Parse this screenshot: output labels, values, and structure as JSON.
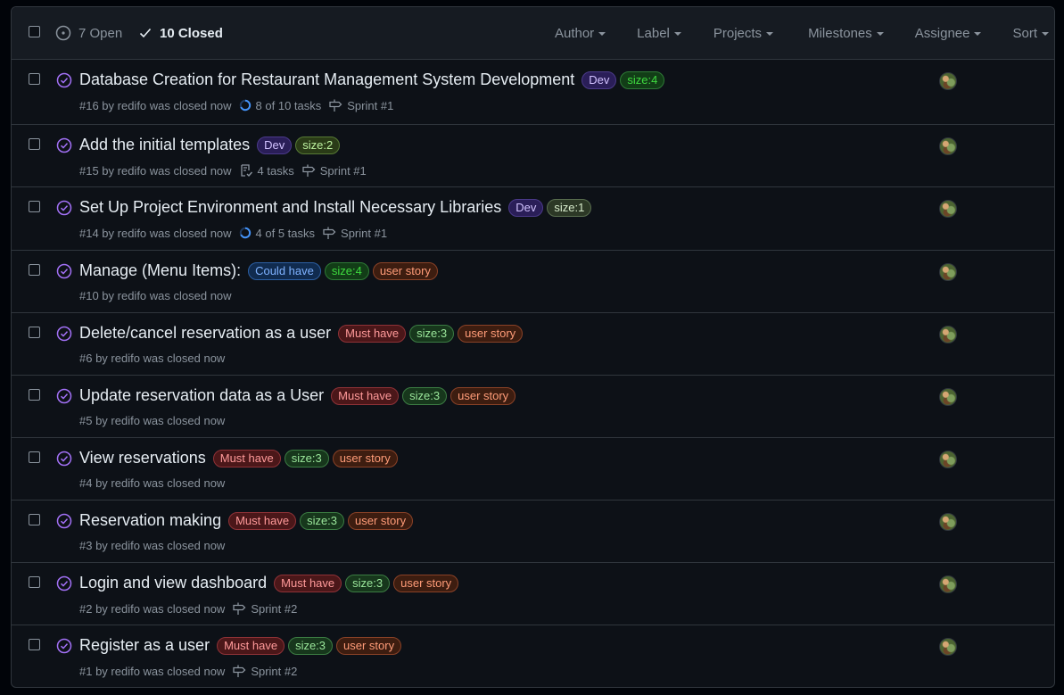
{
  "header": {
    "open_label": "7 Open",
    "closed_label": "10 Closed",
    "filters": [
      "Author",
      "Label",
      "Projects",
      "Milestones",
      "Assignee",
      "Sort"
    ]
  },
  "colors": {
    "closed_icon": "#a371f7",
    "background": "#0d1117",
    "header_bg": "#161b22",
    "border": "#30363d"
  },
  "issues": [
    {
      "title": "Database Creation for Restaurant Management System Development",
      "labels": [
        {
          "text": "Dev",
          "kind": "dev"
        },
        {
          "text": "size:4",
          "kind": "size4"
        }
      ],
      "meta": "#16 by redifo was closed now",
      "tasks": "8 of 10 tasks",
      "tasks_icon": "progress-ring-icon",
      "milestone": "Sprint #1"
    },
    {
      "title": "Add the initial templates",
      "labels": [
        {
          "text": "Dev",
          "kind": "dev"
        },
        {
          "text": "size:2",
          "kind": "size2"
        }
      ],
      "meta": "#15 by redifo was closed now",
      "tasks": "4 tasks",
      "tasks_icon": "checklist-icon",
      "milestone": "Sprint #1"
    },
    {
      "title": "Set Up Project Environment and Install Necessary Libraries",
      "labels": [
        {
          "text": "Dev",
          "kind": "dev"
        },
        {
          "text": "size:1",
          "kind": "size1"
        }
      ],
      "meta": "#14 by redifo was closed now",
      "tasks": "4 of 5 tasks",
      "tasks_icon": "progress-ring-icon",
      "milestone": "Sprint #1"
    },
    {
      "title": "Manage (Menu Items):",
      "labels": [
        {
          "text": "Could have",
          "kind": "could"
        },
        {
          "text": "size:4",
          "kind": "size4"
        },
        {
          "text": "user story",
          "kind": "story"
        }
      ],
      "meta": "#10 by redifo was closed now",
      "tasks": "",
      "milestone": ""
    },
    {
      "title": "Delete/cancel reservation as a user",
      "labels": [
        {
          "text": "Must have",
          "kind": "must"
        },
        {
          "text": "size:3",
          "kind": "size3"
        },
        {
          "text": "user story",
          "kind": "story"
        }
      ],
      "meta": "#6 by redifo was closed now",
      "tasks": "",
      "milestone": ""
    },
    {
      "title": "Update reservation data as a User",
      "labels": [
        {
          "text": "Must have",
          "kind": "must"
        },
        {
          "text": "size:3",
          "kind": "size3"
        },
        {
          "text": "user story",
          "kind": "story"
        }
      ],
      "meta": "#5 by redifo was closed now",
      "tasks": "",
      "milestone": ""
    },
    {
      "title": "View reservations",
      "labels": [
        {
          "text": "Must have",
          "kind": "must"
        },
        {
          "text": "size:3",
          "kind": "size3"
        },
        {
          "text": "user story",
          "kind": "story"
        }
      ],
      "meta": "#4 by redifo was closed now",
      "tasks": "",
      "milestone": ""
    },
    {
      "title": "Reservation making",
      "labels": [
        {
          "text": "Must have",
          "kind": "must"
        },
        {
          "text": "size:3",
          "kind": "size3"
        },
        {
          "text": "user story",
          "kind": "story"
        }
      ],
      "meta": "#3 by redifo was closed now",
      "tasks": "",
      "milestone": ""
    },
    {
      "title": "Login and view dashboard",
      "labels": [
        {
          "text": "Must have",
          "kind": "must"
        },
        {
          "text": "size:3",
          "kind": "size3"
        },
        {
          "text": "user story",
          "kind": "story"
        }
      ],
      "meta": "#2 by redifo was closed now",
      "tasks": "",
      "milestone": "Sprint #2"
    },
    {
      "title": "Register as a user",
      "labels": [
        {
          "text": "Must have",
          "kind": "must"
        },
        {
          "text": "size:3",
          "kind": "size3"
        },
        {
          "text": "user story",
          "kind": "story"
        }
      ],
      "meta": "#1 by redifo was closed now",
      "tasks": "",
      "milestone": "Sprint #2"
    }
  ]
}
